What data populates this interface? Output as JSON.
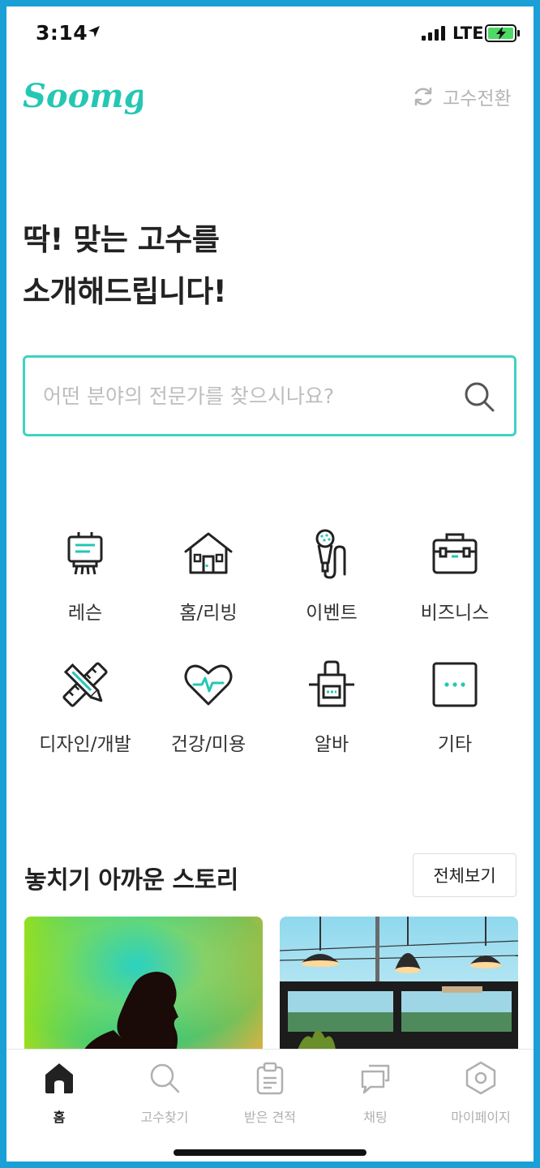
{
  "status_bar": {
    "time": "3:14",
    "network": "LTE"
  },
  "header": {
    "logo_text": "Soomgo",
    "switch_label": "고수전환"
  },
  "hero": {
    "title": "딱! 맞는 고수를\n소개해드립니다!"
  },
  "search": {
    "placeholder": "어떤 분야의 전문가를 찾으시나요?",
    "value": ""
  },
  "categories": [
    {
      "label": "레슨",
      "icon": "easel-icon"
    },
    {
      "label": "홈/리빙",
      "icon": "house-icon"
    },
    {
      "label": "이벤트",
      "icon": "microphone-icon"
    },
    {
      "label": "비즈니스",
      "icon": "briefcase-icon"
    },
    {
      "label": "디자인/개발",
      "icon": "pencil-ruler-icon"
    },
    {
      "label": "건강/미용",
      "icon": "heartbeat-icon"
    },
    {
      "label": "알바",
      "icon": "apron-icon"
    },
    {
      "label": "기타",
      "icon": "more-icon"
    }
  ],
  "stories": {
    "title": "놓치기 아까운 스토리",
    "view_all_label": "전체보기"
  },
  "tab_bar": {
    "tabs": [
      {
        "label": "홈",
        "icon": "home-icon",
        "active": true
      },
      {
        "label": "고수찾기",
        "icon": "search-icon",
        "active": false
      },
      {
        "label": "받은 견적",
        "icon": "clipboard-icon",
        "active": false
      },
      {
        "label": "채팅",
        "icon": "chat-icon",
        "active": false
      },
      {
        "label": "마이페이지",
        "icon": "profile-hexagon-icon",
        "active": false
      }
    ]
  },
  "colors": {
    "brand": "#25c7b3",
    "accent_border": "#3ed3c2",
    "frame": "#1aa0d6"
  }
}
